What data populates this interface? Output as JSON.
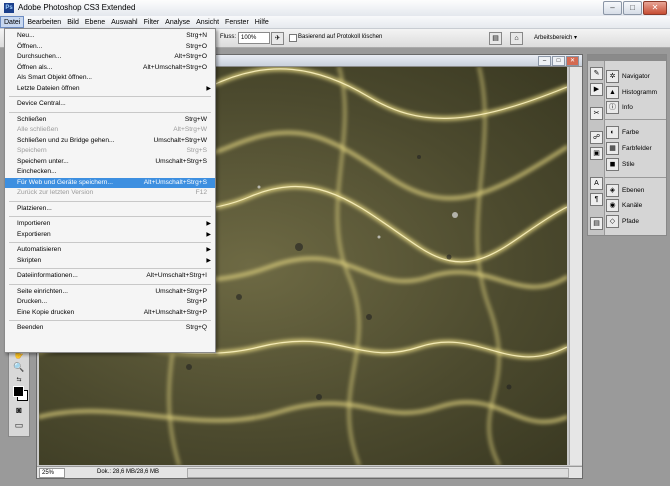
{
  "window": {
    "title": "Adobe Photoshop CS3 Extended",
    "app_icon": "Ps",
    "min": "–",
    "max": "□",
    "close": "✕"
  },
  "menubar": [
    "Datei",
    "Bearbeiten",
    "Bild",
    "Ebene",
    "Auswahl",
    "Filter",
    "Analyse",
    "Ansicht",
    "Fenster",
    "Hilfe"
  ],
  "options": {
    "fluss_label": "Fluss:",
    "fluss_value": "100%",
    "checkbox_label": "Basierend auf Protokoll löschen",
    "workspace": "Arbeitsbereich ▾"
  },
  "file_menu": [
    {
      "label": "Neu...",
      "shortcut": "Strg+N"
    },
    {
      "label": "Öffnen...",
      "shortcut": "Strg+O"
    },
    {
      "label": "Durchsuchen...",
      "shortcut": "Alt+Strg+O"
    },
    {
      "label": "Öffnen als...",
      "shortcut": "Alt+Umschalt+Strg+O"
    },
    {
      "label": "Als Smart Objekt öffnen...",
      "shortcut": ""
    },
    {
      "label": "Letzte Dateien öffnen",
      "shortcut": "",
      "submenu": true
    },
    {
      "sep": true
    },
    {
      "label": "Device Central...",
      "shortcut": ""
    },
    {
      "sep": true
    },
    {
      "label": "Schließen",
      "shortcut": "Strg+W"
    },
    {
      "label": "Alle schließen",
      "shortcut": "Alt+Strg+W",
      "disabled": true
    },
    {
      "label": "Schließen und zu Bridge gehen...",
      "shortcut": "Umschalt+Strg+W"
    },
    {
      "label": "Speichern",
      "shortcut": "Strg+S",
      "disabled": true
    },
    {
      "label": "Speichern unter...",
      "shortcut": "Umschalt+Strg+S"
    },
    {
      "label": "Einchecken...",
      "shortcut": ""
    },
    {
      "label": "Für Web und Geräte speichern...",
      "shortcut": "Alt+Umschalt+Strg+S",
      "highlight": true
    },
    {
      "label": "Zurück zur letzten Version",
      "shortcut": "F12",
      "disabled": true
    },
    {
      "sep": true
    },
    {
      "label": "Platzieren...",
      "shortcut": ""
    },
    {
      "sep": true
    },
    {
      "label": "Importieren",
      "shortcut": "",
      "submenu": true
    },
    {
      "label": "Exportieren",
      "shortcut": "",
      "submenu": true
    },
    {
      "sep": true
    },
    {
      "label": "Automatisieren",
      "shortcut": "",
      "submenu": true
    },
    {
      "label": "Skripten",
      "shortcut": "",
      "submenu": true
    },
    {
      "sep": true
    },
    {
      "label": "Dateiinformationen...",
      "shortcut": "Alt+Umschalt+Strg+I"
    },
    {
      "sep": true
    },
    {
      "label": "Seite einrichten...",
      "shortcut": "Umschalt+Strg+P"
    },
    {
      "label": "Drucken...",
      "shortcut": "Strg+P"
    },
    {
      "label": "Eine Kopie drucken",
      "shortcut": "Alt+Umschalt+Strg+P"
    },
    {
      "sep": true
    },
    {
      "label": "Beenden",
      "shortcut": "Strg+Q"
    }
  ],
  "panels": [
    {
      "label": "Navigator",
      "icon": "navigator-icon",
      "glyph": "✲"
    },
    {
      "label": "Histogramm",
      "icon": "histogram-icon",
      "glyph": "▲"
    },
    {
      "label": "Info",
      "icon": "info-icon",
      "glyph": "ⓘ"
    },
    {
      "label": "Farbe",
      "icon": "color-icon",
      "glyph": "◐"
    },
    {
      "label": "Farbfelder",
      "icon": "swatches-icon",
      "glyph": "▦"
    },
    {
      "label": "Stile",
      "icon": "styles-icon",
      "glyph": "◼"
    },
    {
      "label": "Ebenen",
      "icon": "layers-icon",
      "glyph": "◈"
    },
    {
      "label": "Kanäle",
      "icon": "channels-icon",
      "glyph": "◉"
    },
    {
      "label": "Pfade",
      "icon": "paths-icon",
      "glyph": "◇"
    }
  ],
  "status": {
    "zoom": "25%",
    "doc": "Dok.: 28,6 MB/28,6 MB"
  }
}
